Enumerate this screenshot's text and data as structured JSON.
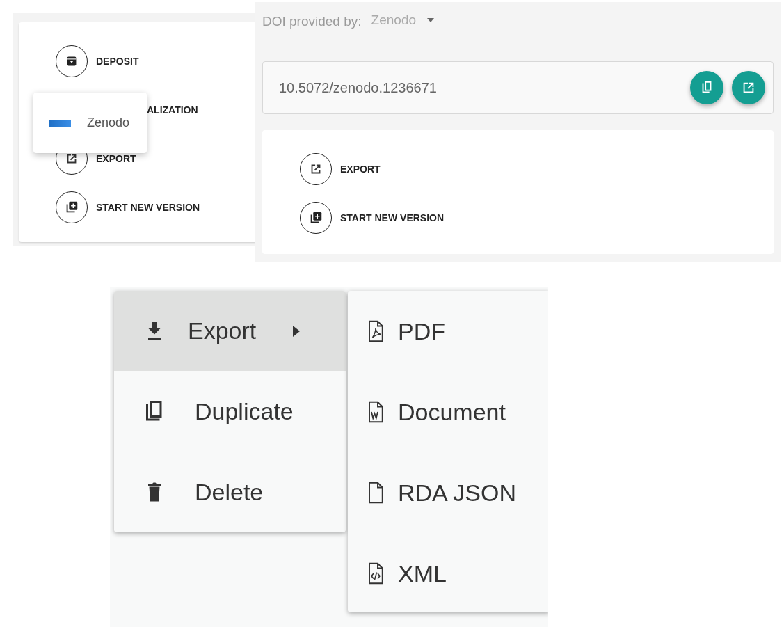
{
  "deposit_panel": {
    "actions": [
      {
        "kind": "action",
        "label": "DEPOSIT"
      },
      {
        "kind": "covered",
        "label": "ALIZATION"
      },
      {
        "kind": "action",
        "label": "EXPORT"
      },
      {
        "kind": "action",
        "label": "START NEW VERSION"
      }
    ],
    "popup": {
      "option": "Zenodo"
    }
  },
  "doi_panel": {
    "provider_label": "DOI provided by:",
    "provider_value": "Zenodo",
    "doi_value": "10.5072/zenodo.1236671",
    "actions": [
      {
        "label": "EXPORT"
      },
      {
        "label": "START NEW VERSION"
      }
    ]
  },
  "context_menu": {
    "items": [
      {
        "label": "Export",
        "selected": true,
        "has_submenu": true
      },
      {
        "label": "Duplicate",
        "selected": false,
        "has_submenu": false
      },
      {
        "label": "Delete",
        "selected": false,
        "has_submenu": false
      }
    ],
    "submenu": [
      "PDF",
      "Document",
      "RDA JSON",
      "XML"
    ]
  }
}
